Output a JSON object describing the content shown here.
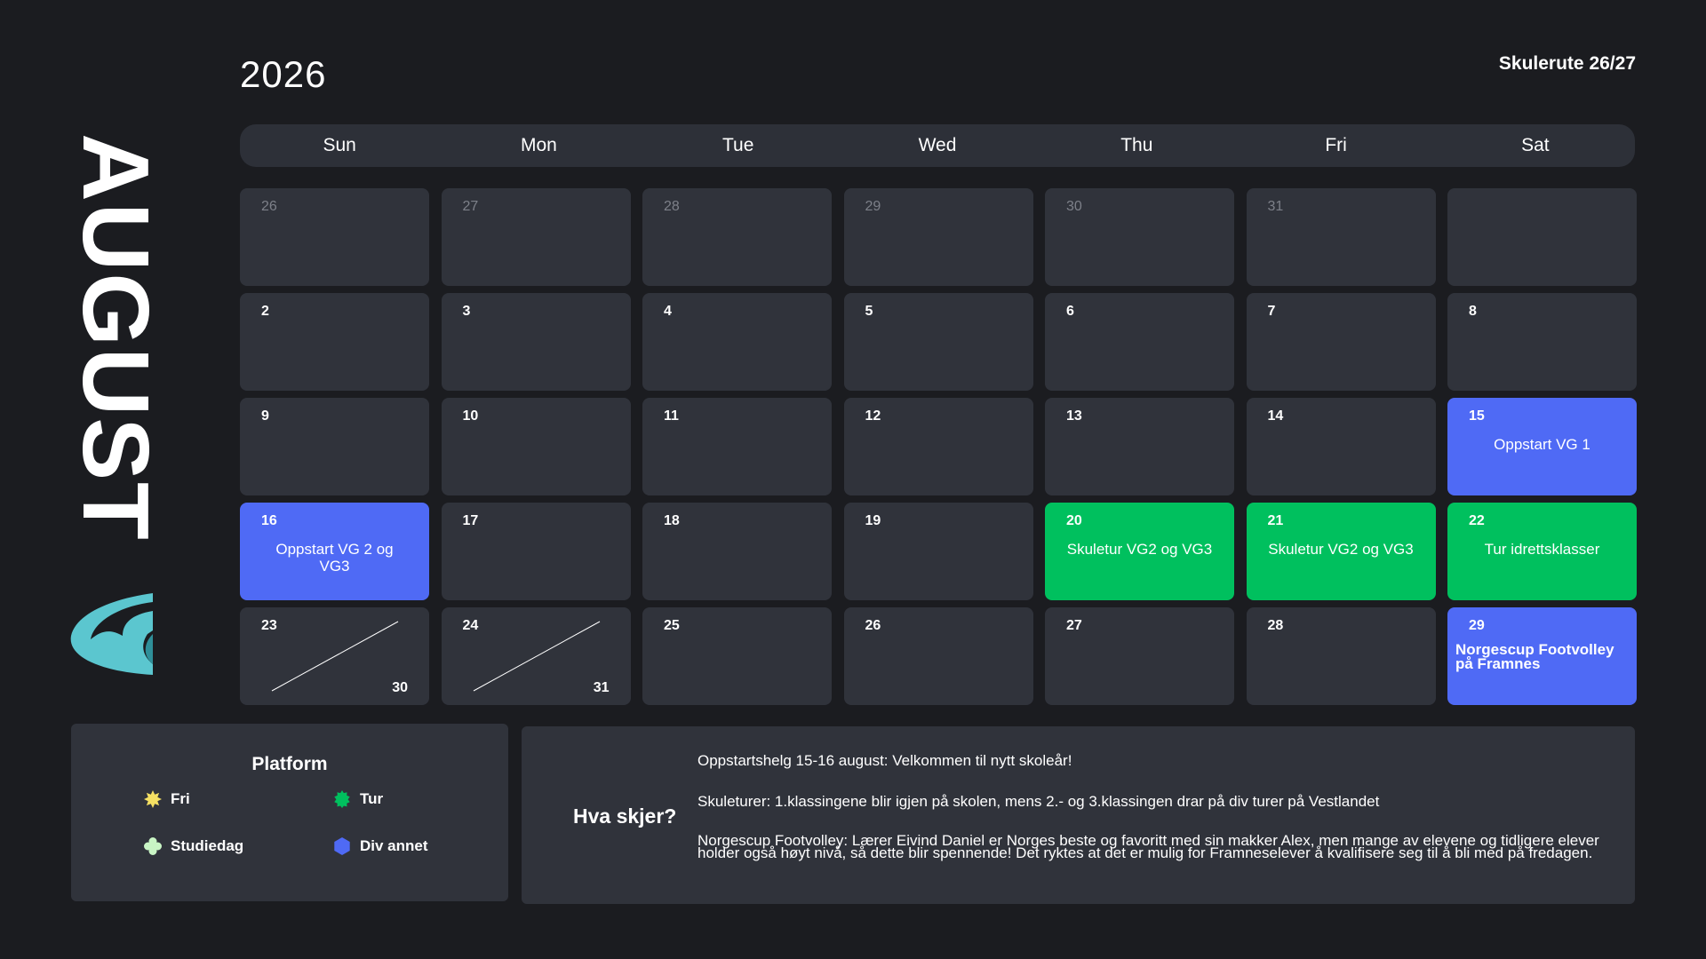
{
  "header": {
    "year": "2026",
    "school_route": "Skulerute 26/27",
    "month": "AUGUST"
  },
  "weekdays": [
    "Sun",
    "Mon",
    "Tue",
    "Wed",
    "Thu",
    "Fri",
    "Sat"
  ],
  "weeks": [
    [
      {
        "day": "26",
        "other_month": true
      },
      {
        "day": "27",
        "other_month": true
      },
      {
        "day": "28",
        "other_month": true
      },
      {
        "day": "29",
        "other_month": true
      },
      {
        "day": "30",
        "other_month": true
      },
      {
        "day": "31",
        "other_month": true
      },
      {
        "day": "",
        "other_month": true
      }
    ],
    [
      {
        "day": "2"
      },
      {
        "day": "3"
      },
      {
        "day": "4"
      },
      {
        "day": "5"
      },
      {
        "day": "6"
      },
      {
        "day": "7"
      },
      {
        "day": "8"
      }
    ],
    [
      {
        "day": "9"
      },
      {
        "day": "10"
      },
      {
        "day": "11"
      },
      {
        "day": "12"
      },
      {
        "day": "13"
      },
      {
        "day": "14"
      },
      {
        "day": "15",
        "color": "blue",
        "event": "Oppstart VG 1"
      }
    ],
    [
      {
        "day": "16",
        "color": "blue",
        "event": "Oppstart VG 2 og VG3"
      },
      {
        "day": "17"
      },
      {
        "day": "18"
      },
      {
        "day": "19"
      },
      {
        "day": "20",
        "color": "green",
        "event": "Skuletur VG2 og VG3"
      },
      {
        "day": "21",
        "color": "green",
        "event": "Skuletur VG2 og VG3"
      },
      {
        "day": "22",
        "color": "green",
        "event": "Tur idrettsklasser"
      }
    ],
    [
      {
        "day": "23",
        "split": "30"
      },
      {
        "day": "24",
        "split": "31"
      },
      {
        "day": "25"
      },
      {
        "day": "26"
      },
      {
        "day": "27"
      },
      {
        "day": "28"
      },
      {
        "day": "29",
        "color": "blue",
        "event": "Norgescup Footvolley på Framnes",
        "align": "left"
      }
    ]
  ],
  "legend": {
    "title": "Platform",
    "items": [
      {
        "label": "Fri",
        "color": "#f5e063",
        "shape": "sun-icon"
      },
      {
        "label": "Tur",
        "color": "#00c05e",
        "shape": "burst-icon"
      },
      {
        "label": "Studiedag",
        "color": "#c9f5c5",
        "shape": "flower-icon"
      },
      {
        "label": "Div annet",
        "color": "#4f6af5",
        "shape": "hexagon-icon"
      }
    ]
  },
  "info": {
    "title": "Hva skjer?",
    "lines": [
      "Oppstartshelg 15-16 august: Velkommen til nytt skoleår!",
      "Skuleturer: 1.klassingene blir igjen på skolen, mens 2.- og 3.klassingen drar på div turer på Vestlandet",
      "Norgescup Footvolley: Lærer Eivind Daniel er Norges beste og favoritt med sin makker Alex, men mange av elevene og tidligere elever holder også høyt nivå, så dette blir spennende! Det ryktes at det er mulig for Framneselever å kvalifisere seg til å bli med på fredagen."
    ]
  },
  "colors": {
    "background": "#1b1c20",
    "cell": "#30333b",
    "blue": "#4f6af5",
    "green": "#00c05e",
    "logo": "#5bc6cf"
  }
}
